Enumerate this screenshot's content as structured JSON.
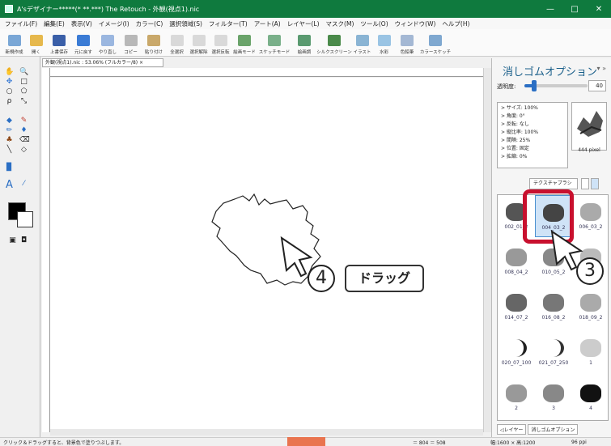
{
  "window": {
    "title": "A'sデザイナー*****(* **.***) The Retouch - 外観(視点1).nic",
    "controls": [
      "—",
      "□",
      "✕"
    ]
  },
  "menu": [
    "ファイル(F)",
    "編集(E)",
    "表示(V)",
    "イメージ(I)",
    "カラー(C)",
    "選択領域(S)",
    "フィルター(T)",
    "アート(A)",
    "レイヤー(L)",
    "マスク(M)",
    "ツール(O)",
    "ウィンドウ(W)",
    "ヘルプ(H)"
  ],
  "toolbar": [
    {
      "label": "新規作成",
      "icon": "new-file-icon",
      "color": "#7aa7d6"
    },
    {
      "label": "開く",
      "icon": "open-folder-icon",
      "color": "#e6b84c"
    },
    {
      "label": "上書保存",
      "icon": "save-icon",
      "color": "#3a5fa8"
    },
    {
      "label": "元に戻す",
      "icon": "undo-icon",
      "color": "#3a7bd5"
    },
    {
      "label": "やり直し",
      "icon": "redo-icon",
      "color": "#9bb7e0"
    },
    {
      "label": "コピー",
      "icon": "copy-icon",
      "color": "#b8b8b8"
    },
    {
      "label": "貼り付け",
      "icon": "paste-icon",
      "color": "#c9a86a"
    },
    {
      "label": "全選択",
      "icon": "select-all-icon",
      "color": "#d9d9d9"
    },
    {
      "label": "選択解除",
      "icon": "deselect-icon",
      "color": "#d9d9d9"
    },
    {
      "label": "選択反転",
      "icon": "invert-selection-icon",
      "color": "#d9d9d9"
    },
    {
      "label": "絵画モード",
      "icon": "paint-mode-icon",
      "color": "#6aa36a"
    },
    {
      "label": "スケッチモード",
      "icon": "sketch-mode-icon",
      "color": "#7ab08a"
    },
    {
      "label": "絵画調",
      "icon": "painting-style-icon",
      "color": "#5a9a70"
    },
    {
      "label": "シルクスクリーン",
      "icon": "silkscreen-icon",
      "color": "#4a8a4a"
    },
    {
      "label": "イラスト",
      "icon": "illustration-icon",
      "color": "#8ab4d4"
    },
    {
      "label": "水彩",
      "icon": "watercolor-icon",
      "color": "#9ac4e4"
    },
    {
      "label": "色鉛筆",
      "icon": "colored-pencil-icon",
      "color": "#a4b8d4"
    },
    {
      "label": "カラースケッチ",
      "icon": "color-sketch-icon",
      "color": "#7fa8d0"
    }
  ],
  "document": {
    "tab": "外観(視点1).nic : 53.06% (フルカラー/8) ×",
    "status_left": "クリック＆ドラッグすると、背景色で塗りつぶします。",
    "status_size": "＝ 804 ＝ 508",
    "status_dim": "幅:1600 × 高:1200",
    "status_dpi": "96 ppi"
  },
  "panel": {
    "title": "消しゴムオプション",
    "menu_glyph": "▾ »",
    "opacity_label": "透明度:",
    "opacity_value": "40",
    "opacity_fraction": 0.15,
    "properties": [
      "> サイズ: 100%",
      "> 角度: 0°",
      "> 反転: なし",
      "> 縦比率: 100%",
      "> 間隔: 25%",
      "> 位置: 固定",
      "> 拡縮: 0%"
    ],
    "preview_size": "444 pixel",
    "brush_set": "テクスチャブラシ",
    "brushes": [
      {
        "label": "002_01_2",
        "color": "#555"
      },
      {
        "label": "004_03_2",
        "color": "#444",
        "selected": true
      },
      {
        "label": "006_03_2",
        "color": "#aaa"
      },
      {
        "label": "008_04_2",
        "color": "#999"
      },
      {
        "label": "010_05_2",
        "color": "#888"
      },
      {
        "label": "012_06_2",
        "color": "#bbb"
      },
      {
        "label": "014_07_2",
        "color": "#666"
      },
      {
        "label": "016_08_2",
        "color": "#777"
      },
      {
        "label": "018_09_2",
        "color": "#aaa"
      },
      {
        "label": "020_07_100",
        "color": "#222"
      },
      {
        "label": "021_07_250",
        "color": "#333"
      },
      {
        "label": "1",
        "color": "#ccc"
      },
      {
        "label": "2",
        "color": "#999"
      },
      {
        "label": "3",
        "color": "#888"
      },
      {
        "label": "4",
        "color": "#111"
      }
    ],
    "tabs": [
      "◁レイヤー",
      "消しゴムオプション"
    ]
  },
  "annotations": {
    "step3": "3",
    "step4": "4",
    "drag_label": "ドラッグ"
  }
}
